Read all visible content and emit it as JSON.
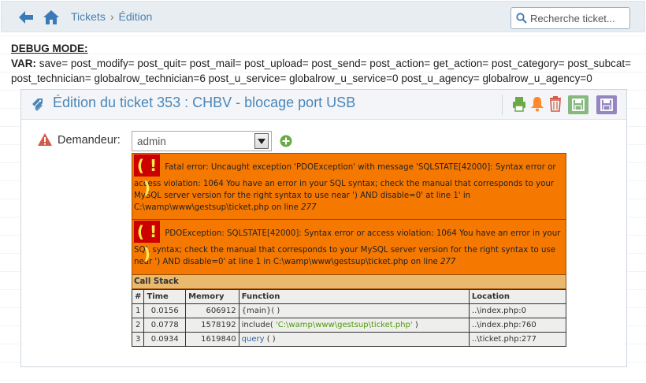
{
  "nav": {
    "breadcrumb": [
      "Tickets",
      "Édition"
    ],
    "breadcrumb_sep": "›",
    "search_placeholder": "Recherche ticket..."
  },
  "debug": {
    "title": "DEBUG MODE:",
    "var_label": "VAR:",
    "var_text": " save= post_modify= post_quit= post_mail= post_upload= post_send= post_action= get_action= post_category= post_subcat= post_technician= globalrow_technician=6 post_u_service= globalrow_u_service=0 post_u_agency= globalrow_u_agency=0"
  },
  "panel": {
    "title": "Édition du ticket 353 : CHBV - blocage port USB",
    "requester_label": "Demandeur:",
    "requester_value": "admin"
  },
  "errors": {
    "badge": "( ! )",
    "fatal_text": " Fatal error: Uncaught exception 'PDOException' with message 'SQLSTATE[42000]: Syntax error or access violation: 1064 You have an error in your SQL syntax; check the manual that corresponds to your MySQL server version for the right syntax to use near ') AND disable=0' at line 1' in C:\\wamp\\www\\gestsup\\ticket.php on line ",
    "fatal_line": "277",
    "pdo_text": " PDOException: SQLSTATE[42000]: Syntax error or access violation: 1064 You have an error in your SQL syntax; check the manual that corresponds to your MySQL server version for the right syntax to use near ') AND disable=0' at line 1 in C:\\wamp\\www\\gestsup\\ticket.php on line ",
    "pdo_line": "277",
    "call_stack_title": "Call Stack",
    "columns": [
      "#",
      "Time",
      "Memory",
      "Function",
      "Location"
    ],
    "rows": [
      {
        "idx": "1",
        "time": "0.0156",
        "memory": "606912",
        "func": "{main}( )",
        "func_arg": "",
        "func_tail": "",
        "location": "..\\index.php:0"
      },
      {
        "idx": "2",
        "time": "0.0778",
        "memory": "1578192",
        "func": "include( ",
        "func_arg": "'C:\\wamp\\www\\gestsup\\ticket.php'",
        "func_tail": " )",
        "location": "..\\index.php:760"
      },
      {
        "idx": "3",
        "time": "0.0934",
        "memory": "1619840",
        "func": "query",
        "func_arg": "",
        "func_tail": " ( )",
        "location": "..\\ticket.php:277"
      }
    ]
  },
  "colors": {
    "accent_blue": "#4a87b9",
    "error_orange": "#f57900",
    "error_badge_red": "#cc0000",
    "callstack_tan": "#e9b96e",
    "save_green": "#87b87f",
    "save_quit_purple": "#9585bf",
    "print_green": "#69aa46",
    "bell_orange": "#ff892a",
    "trash_red": "#d15b47"
  },
  "icons": {
    "back": "arrow-left-icon",
    "home": "home-icon",
    "search": "search-icon",
    "ticket": "tag-icon",
    "print": "print-icon",
    "bell": "bell-icon",
    "trash": "trash-icon",
    "save": "save-icon",
    "save_quit": "save-quit-icon",
    "warning": "warning-icon",
    "add": "plus-circle-icon"
  }
}
